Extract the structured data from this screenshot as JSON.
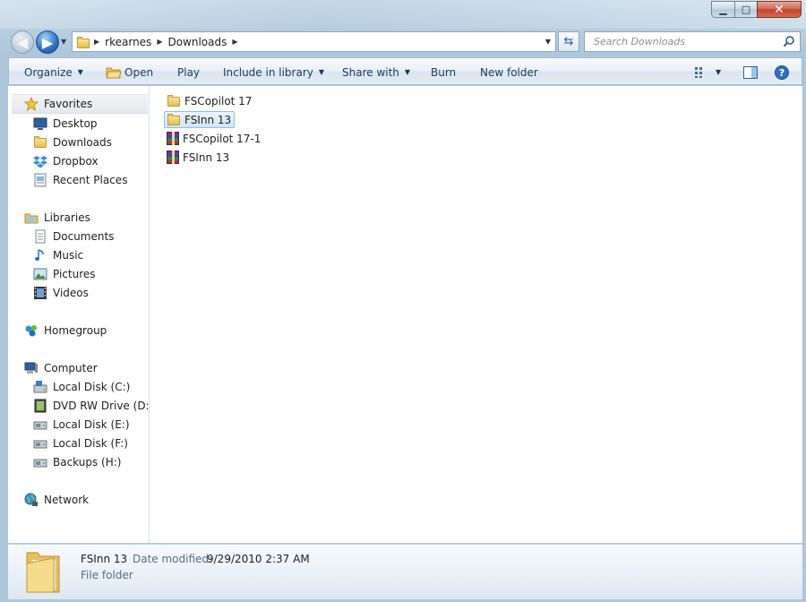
{
  "window": {
    "controls": {
      "minimize": "▁",
      "maximize": "□",
      "close": "✕"
    }
  },
  "address_bar": {
    "crumbs": [
      "rkearnes",
      "Downloads"
    ],
    "search_placeholder": "Search Downloads"
  },
  "toolbar": {
    "organize": "Organize",
    "open": "Open",
    "play": "Play",
    "include_in_library": "Include in library",
    "share_with": "Share with",
    "burn": "Burn",
    "new_folder": "New folder"
  },
  "nav": {
    "favorites": "Favorites",
    "favorites_items": [
      "Desktop",
      "Downloads",
      "Dropbox",
      "Recent Places"
    ],
    "libraries": "Libraries",
    "libraries_items": [
      "Documents",
      "Music",
      "Pictures",
      "Videos"
    ],
    "homegroup": "Homegroup",
    "computer": "Computer",
    "computer_items": [
      "Local Disk (C:)",
      "DVD RW Drive (D:) G",
      "Local Disk (E:)",
      "Local Disk (F:)",
      "Backups (H:)"
    ],
    "network": "Network"
  },
  "files": [
    {
      "name": "FSCopilot 17",
      "type": "folder"
    },
    {
      "name": "FSInn 13",
      "type": "folder",
      "selected": true
    },
    {
      "name": "FSCopilot 17-1",
      "type": "archive"
    },
    {
      "name": "FSInn 13",
      "type": "archive"
    }
  ],
  "details": {
    "name": "FSInn 13",
    "date_label": "Date modified:",
    "date_value": "9/29/2010 2:37 AM",
    "type": "File folder"
  },
  "colors": {
    "selection": "#d2e6f8",
    "toolbar_text": "#1e395b"
  }
}
